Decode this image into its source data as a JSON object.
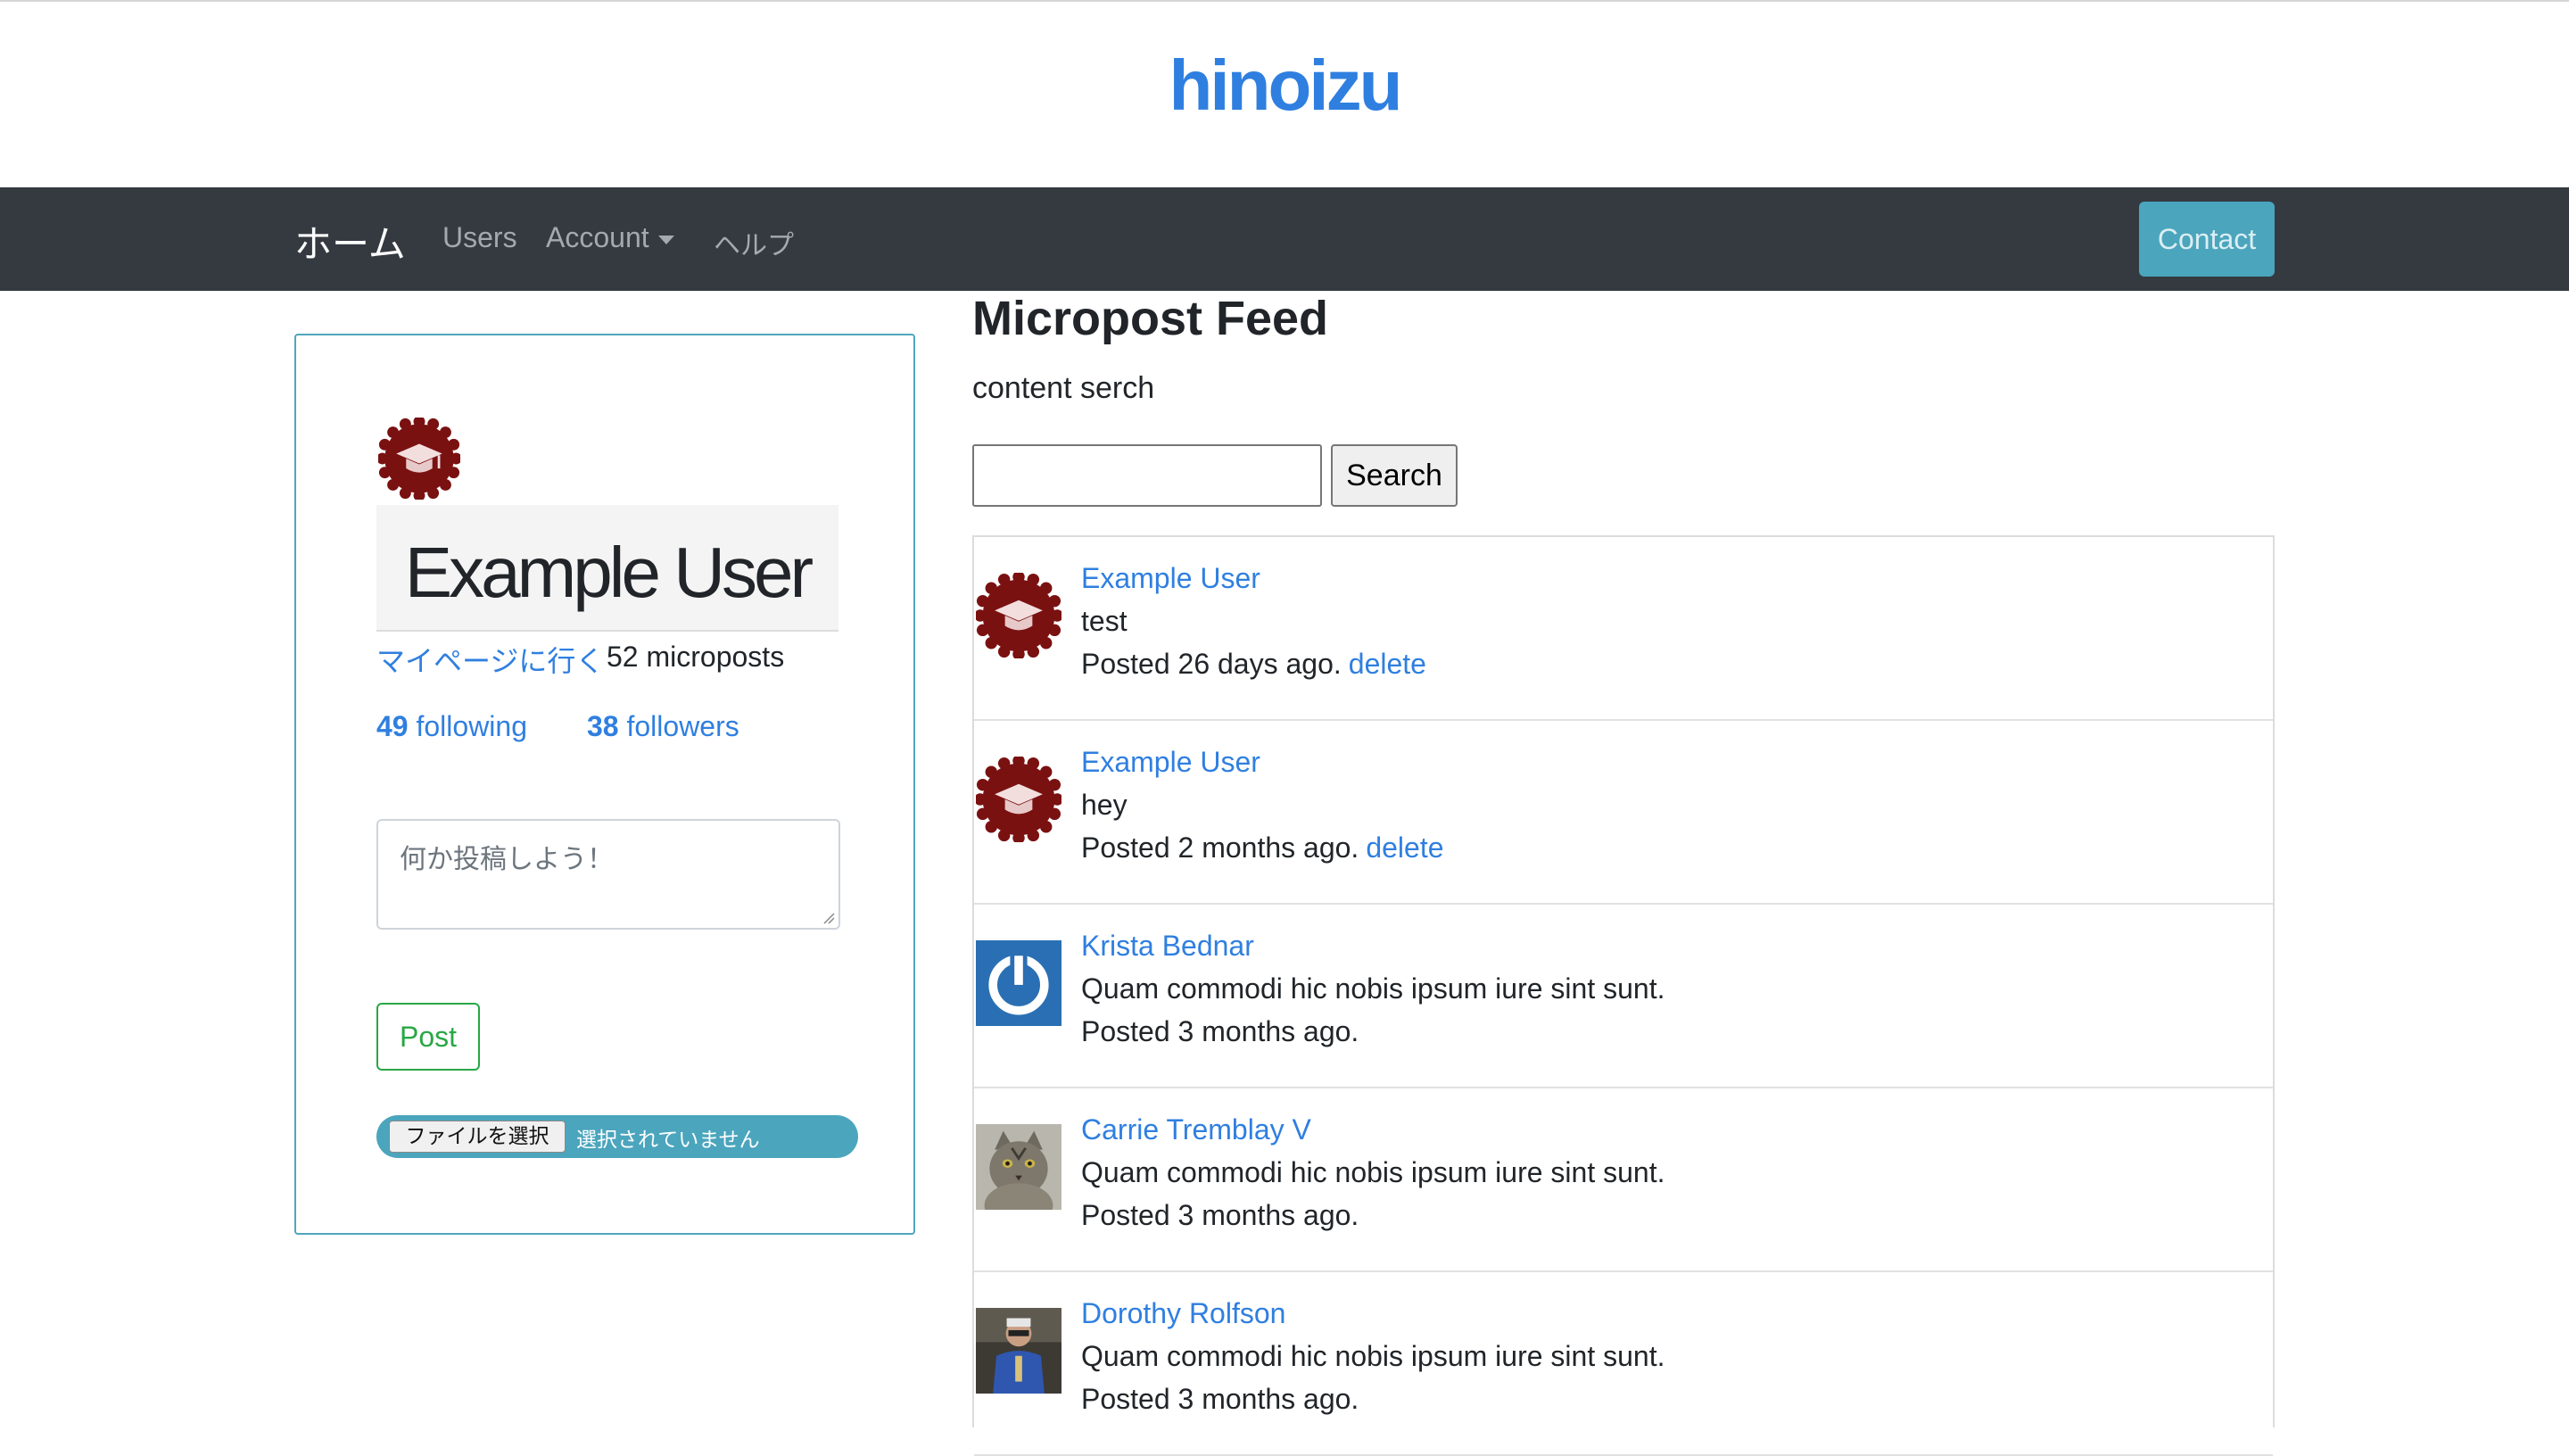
{
  "header": {
    "brand": "hinoizu"
  },
  "nav": {
    "home": "ホーム",
    "users": "Users",
    "account": "Account",
    "help": "ヘルプ",
    "contact": "Contact"
  },
  "profile": {
    "name": "Example User",
    "mypage_link": "マイページに行く",
    "micropost_count": "52 microposts",
    "following_count": "49",
    "following_label": "following",
    "followers_count": "38",
    "followers_label": "followers",
    "post_placeholder": "何か投稿しよう！",
    "post_button": "Post",
    "file_button": "ファイルを選択",
    "file_status": "選択されていません"
  },
  "feed": {
    "title": "Micropost Feed",
    "search_label": "content serch",
    "search_value": "",
    "search_button": "Search",
    "items": [
      {
        "author": "Example User",
        "content": "test",
        "posted": "Posted 26 days ago.",
        "delete": "delete",
        "avatar": "graduation-cap-badge"
      },
      {
        "author": "Example User",
        "content": "hey",
        "posted": "Posted 2 months ago.",
        "delete": "delete",
        "avatar": "graduation-cap-badge"
      },
      {
        "author": "Krista Bednar",
        "content": "Quam commodi hic nobis ipsum iure sint sunt.",
        "posted": "Posted 3 months ago.",
        "delete": "",
        "avatar": "power-icon"
      },
      {
        "author": "Carrie Tremblay V",
        "content": "Quam commodi hic nobis ipsum iure sint sunt.",
        "posted": "Posted 3 months ago.",
        "delete": "",
        "avatar": "cat-photo"
      },
      {
        "author": "Dorothy Rolfson",
        "content": "Quam commodi hic nobis ipsum iure sint sunt.",
        "posted": "Posted 3 months ago.",
        "delete": "",
        "avatar": "person-photo"
      }
    ]
  },
  "colors": {
    "link": "#2f7fe0",
    "navbar": "#343a40",
    "contact": "#4ba5bd",
    "card_border": "#4ea7bb",
    "post_green": "#28a745",
    "badge_red": "#7a1111"
  }
}
